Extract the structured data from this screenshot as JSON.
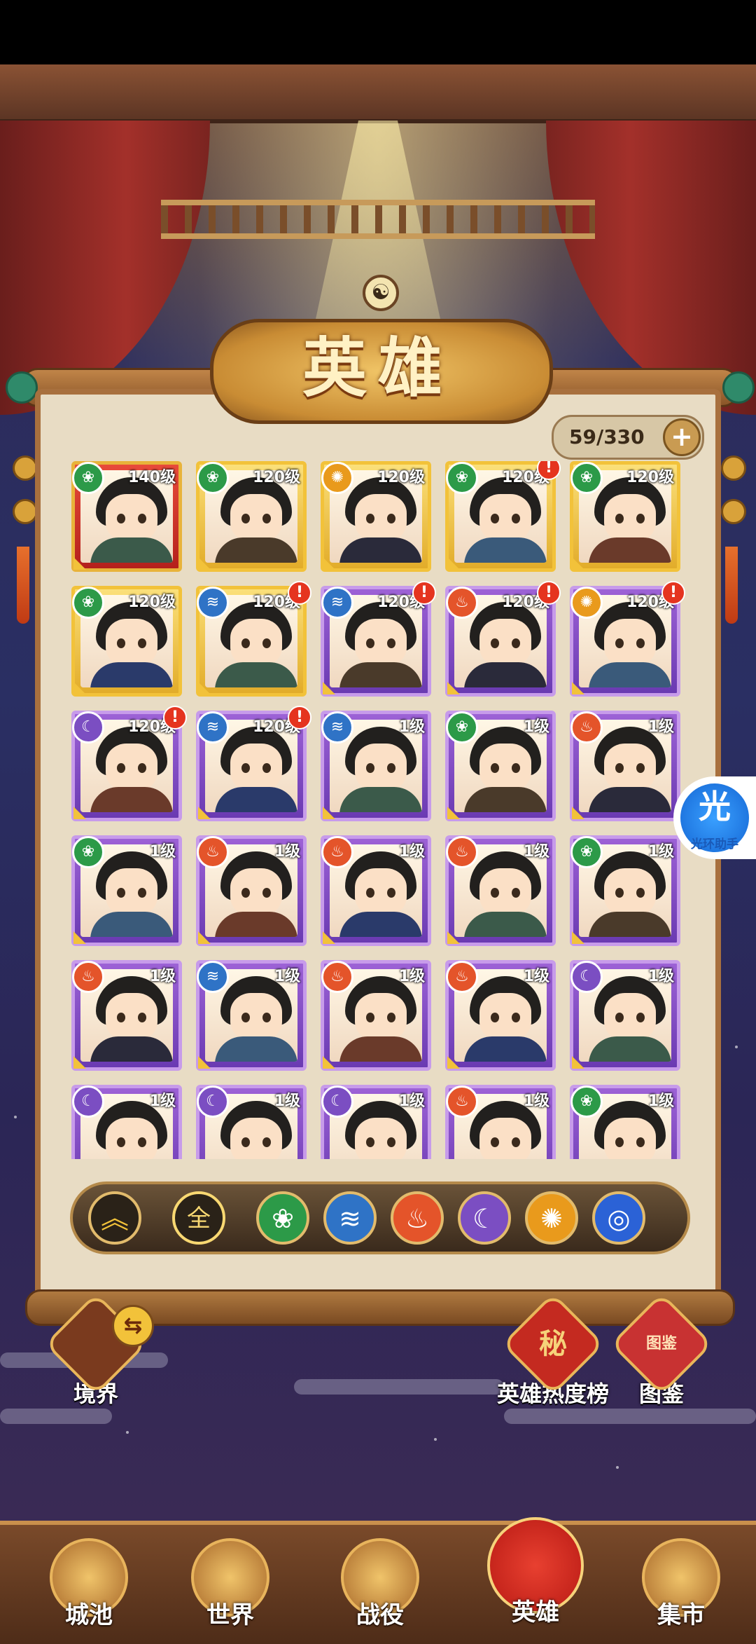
{
  "title": "英雄",
  "collection": {
    "count": "59/330",
    "add_icon": "plus-icon"
  },
  "heroes": [
    {
      "level": "140级",
      "element": "wood",
      "frame": "red",
      "alert": false
    },
    {
      "level": "120级",
      "element": "wood",
      "frame": "gold",
      "alert": false
    },
    {
      "level": "120级",
      "element": "sun",
      "frame": "gold",
      "alert": false
    },
    {
      "level": "120级",
      "element": "wood",
      "frame": "gold",
      "alert": true
    },
    {
      "level": "120级",
      "element": "wood",
      "frame": "gold",
      "alert": false
    },
    {
      "level": "120级",
      "element": "wood",
      "frame": "gold",
      "alert": false
    },
    {
      "level": "120级",
      "element": "water",
      "frame": "gold",
      "alert": true
    },
    {
      "level": "120级",
      "element": "water",
      "frame": "purple",
      "alert": true
    },
    {
      "level": "120级",
      "element": "fire",
      "frame": "purple",
      "alert": true
    },
    {
      "level": "120级",
      "element": "sun",
      "frame": "purple",
      "alert": true
    },
    {
      "level": "120级",
      "element": "moon",
      "frame": "purple",
      "alert": true
    },
    {
      "level": "120级",
      "element": "water",
      "frame": "purple",
      "alert": true
    },
    {
      "level": "1级",
      "element": "water",
      "frame": "purple",
      "alert": false
    },
    {
      "level": "1级",
      "element": "wood",
      "frame": "purple",
      "alert": false
    },
    {
      "level": "1级",
      "element": "fire",
      "frame": "purple",
      "alert": false
    },
    {
      "level": "1级",
      "element": "wood",
      "frame": "purple",
      "alert": false
    },
    {
      "level": "1级",
      "element": "fire",
      "frame": "purple",
      "alert": false
    },
    {
      "level": "1级",
      "element": "fire",
      "frame": "purple",
      "alert": false
    },
    {
      "level": "1级",
      "element": "fire",
      "frame": "purple",
      "alert": false
    },
    {
      "level": "1级",
      "element": "wood",
      "frame": "purple",
      "alert": false
    },
    {
      "level": "1级",
      "element": "fire",
      "frame": "purple",
      "alert": false
    },
    {
      "level": "1级",
      "element": "water",
      "frame": "purple",
      "alert": false
    },
    {
      "level": "1级",
      "element": "fire",
      "frame": "purple",
      "alert": false
    },
    {
      "level": "1级",
      "element": "fire",
      "frame": "purple",
      "alert": false
    },
    {
      "level": "1级",
      "element": "moon",
      "frame": "purple",
      "alert": false
    },
    {
      "level": "1级",
      "element": "moon",
      "frame": "purple",
      "alert": false
    },
    {
      "level": "1级",
      "element": "moon",
      "frame": "purple",
      "alert": false
    },
    {
      "level": "1级",
      "element": "moon",
      "frame": "purple",
      "alert": false
    },
    {
      "level": "1级",
      "element": "fire",
      "frame": "purple",
      "alert": false
    },
    {
      "level": "1级",
      "element": "wood",
      "frame": "purple",
      "alert": false
    }
  ],
  "filters": {
    "sort_icon": "double-chevron-up-icon",
    "all_label": "全",
    "elements": [
      "wood",
      "water",
      "fire",
      "moon",
      "sun",
      "vortex"
    ]
  },
  "side_buttons": {
    "realm": "境界",
    "popularity": "英雄热度榜",
    "codex": "图鉴",
    "codex_badge": "图鉴"
  },
  "popularity_seal": "秘",
  "helper": {
    "char": "光",
    "label": "光环助手"
  },
  "nav": [
    {
      "label": "城池",
      "icon": "castle-icon"
    },
    {
      "label": "世界",
      "icon": "mountain-icon"
    },
    {
      "label": "战役",
      "icon": "crossed-swords-icon"
    },
    {
      "label": "英雄",
      "icon": "hero-icon",
      "active": true
    },
    {
      "label": "集市",
      "icon": "market-icon"
    }
  ],
  "colors": {
    "wood": "#2c9a48",
    "water": "#2f73c6",
    "fire": "#e4542a",
    "moon": "#7b4ec2",
    "sun": "#e99a1c",
    "vortex": "#2b62d6"
  }
}
